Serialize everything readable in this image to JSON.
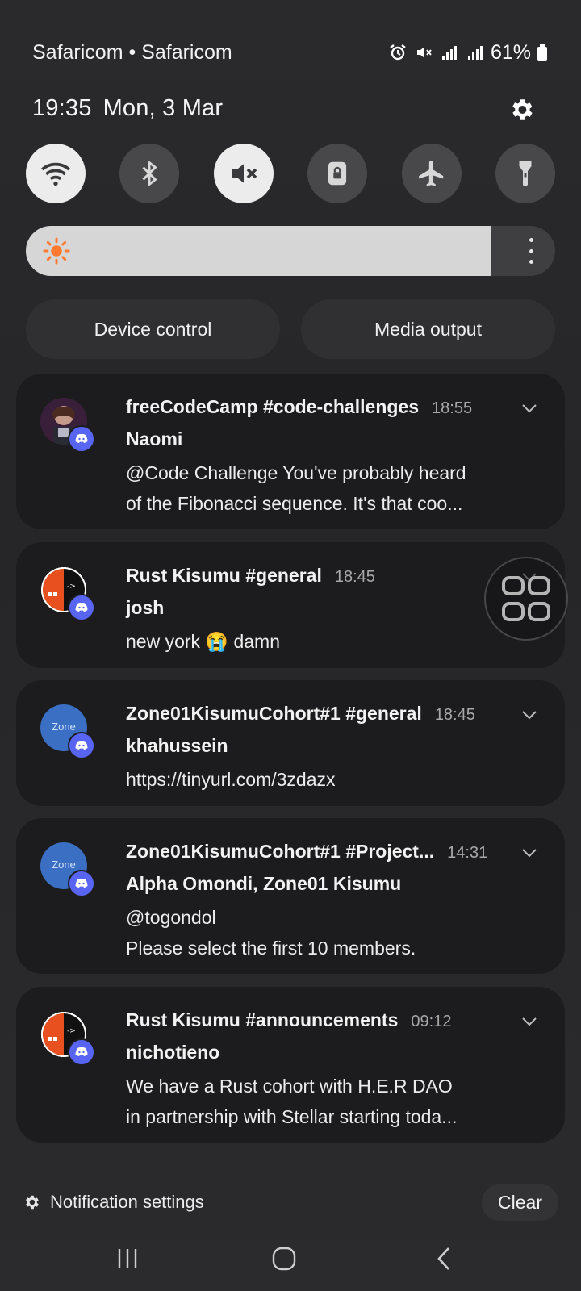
{
  "status_bar": {
    "carrier": "Safaricom • Safaricom",
    "battery": "61%",
    "icons": [
      "alarm-icon",
      "mute-icon",
      "signal-icon",
      "signal-icon",
      "battery-icon"
    ]
  },
  "header": {
    "time": "19:35",
    "date": "Mon, 3 Mar"
  },
  "quick_settings": [
    {
      "name": "wifi",
      "icon": "wifi-icon",
      "on": true
    },
    {
      "name": "bluetooth",
      "icon": "bluetooth-icon",
      "on": false
    },
    {
      "name": "sound",
      "icon": "mute-icon",
      "on": true
    },
    {
      "name": "rotation-lock",
      "icon": "lock-icon",
      "on": false
    },
    {
      "name": "airplane",
      "icon": "airplane-icon",
      "on": false
    },
    {
      "name": "flashlight",
      "icon": "flashlight-icon",
      "on": false
    }
  ],
  "brightness": {
    "level": 0.88,
    "icon": "sun-icon"
  },
  "pills": {
    "device_control": "Device control",
    "media_output": "Media output"
  },
  "notifications": [
    {
      "title": "freeCodeCamp #code-challenges",
      "time": "18:55",
      "sender": "Naomi",
      "lines": [
        "@Code Challenge You've probably heard",
        "of the Fibonacci sequence. It's that coo..."
      ]
    },
    {
      "title": "Rust Kisumu #general",
      "time": "18:45",
      "sender": "josh",
      "lines": [
        "new york 😭 damn"
      ]
    },
    {
      "title": "Zone01KisumuCohort#1 #general",
      "time": "18:45",
      "sender": "khahussein",
      "lines": [
        "https://tinyurl.com/3zdazx"
      ],
      "avatar_text": "Zone"
    },
    {
      "title": "Zone01KisumuCohort#1 #Project...",
      "time": "14:31",
      "sender": "Alpha Omondi, Zone01 Kisumu",
      "lines": [
        "@togondol",
        "Please select the first 10 members."
      ],
      "avatar_text": "Zone"
    },
    {
      "title": "Rust Kisumu #announcements",
      "time": "09:12",
      "sender": "nichotieno",
      "lines": [
        "We have a Rust cohort with H.E.R DAO",
        "in partnership with Stellar starting toda..."
      ]
    }
  ],
  "footer": {
    "settings_label": "Notification settings",
    "clear_label": "Clear"
  },
  "colors": {
    "discord_badge": "#5865f2",
    "sun": "#ff7a2e",
    "card_bg": "#1c1c1e"
  }
}
